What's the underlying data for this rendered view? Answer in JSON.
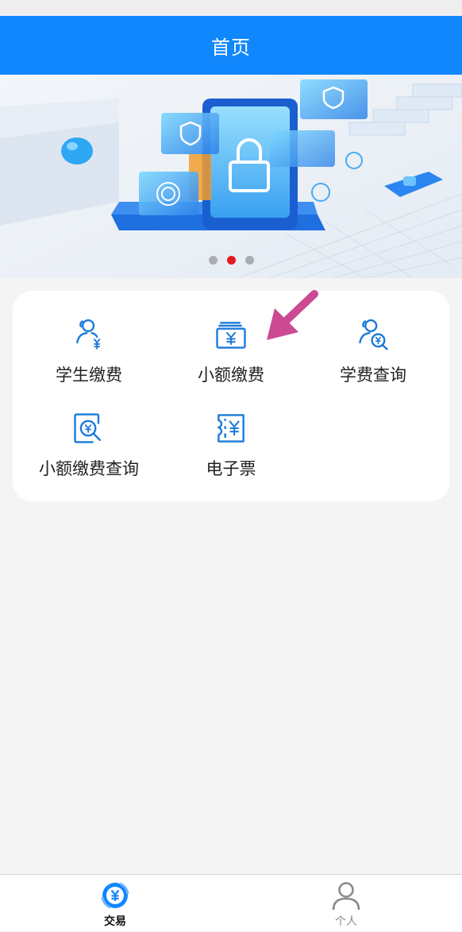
{
  "header": {
    "title": "首页"
  },
  "banner": {
    "slides": 3,
    "active_slide": 2
  },
  "menu": {
    "items": [
      {
        "label": "学生缴费",
        "icon": "student-payment-icon"
      },
      {
        "label": "小额缴费",
        "icon": "small-payment-icon"
      },
      {
        "label": "学费查询",
        "icon": "tuition-query-icon"
      },
      {
        "label": "小额缴费查询",
        "icon": "small-payment-query-icon"
      },
      {
        "label": "电子票",
        "icon": "e-ticket-icon"
      }
    ]
  },
  "tabbar": {
    "tabs": [
      {
        "label": "交易",
        "icon": "yuan-circle-icon",
        "active": true
      },
      {
        "label": "个人",
        "icon": "person-icon",
        "active": false
      }
    ]
  },
  "colors": {
    "primary": "#1187fd",
    "icon_blue": "#1a7ad9",
    "dot_active": "#e31b1b",
    "annotation_arrow": "#cc4a92"
  }
}
